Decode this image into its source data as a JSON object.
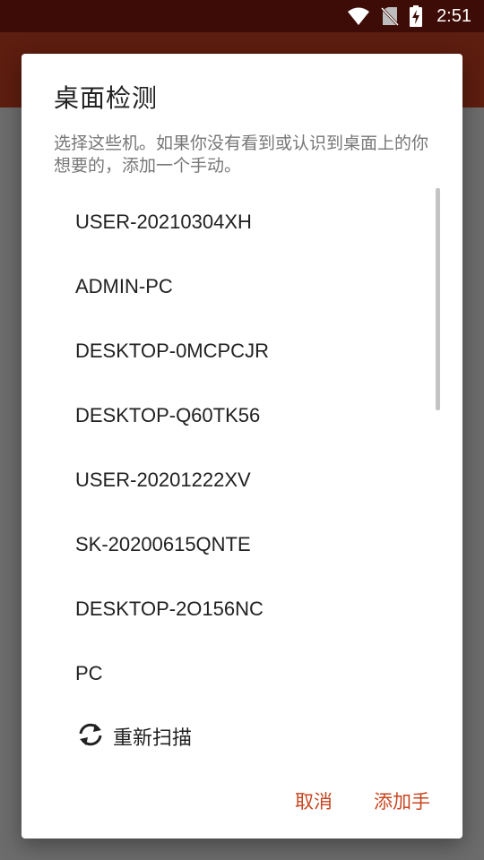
{
  "status_bar": {
    "time": "2:51",
    "icons": [
      "wifi-icon",
      "no-sim-icon",
      "battery-charging-icon"
    ]
  },
  "dialog": {
    "title": "桌面检测",
    "message": "选择这些机。如果你没有看到或认识到桌面上的你想要的，添加一个手动。",
    "devices": [
      "USER-20210304XH",
      "ADMIN-PC",
      "DESKTOP-0MCPCJR",
      "DESKTOP-Q60TK56",
      "USER-20201222XV",
      "SK-20200615QNTE",
      "DESKTOP-2O156NC",
      "PC"
    ],
    "rescan_label": "重新扫描",
    "rescan_icon": "refresh-icon",
    "cancel_label": "取消",
    "add_manual_label": "添加手"
  },
  "colors": {
    "status_bar": "#3e0c06",
    "app_bar": "#5d1d0f",
    "accent": "#c8451f"
  }
}
